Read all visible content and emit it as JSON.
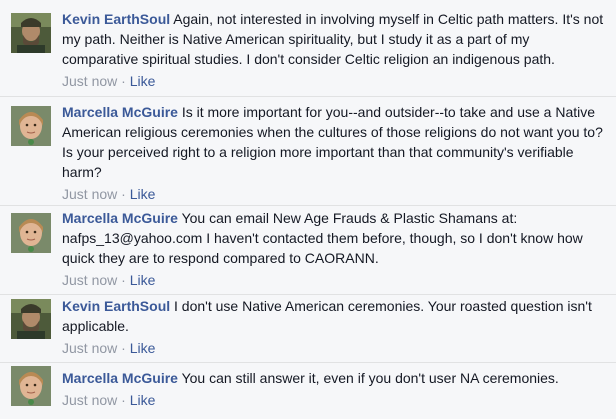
{
  "comments": [
    {
      "author": "Kevin EarthSoul",
      "avatar": "kevin-avatar",
      "text": "Again, not interested in involving myself in Celtic path matters. It's not my path. Neither is Native American spirituality, but I study it as a part of my comparative spiritual studies. I don't consider Celtic religion an indigenous path.",
      "time": "Just now",
      "separator": "·",
      "like_label": "Like"
    },
    {
      "author": "Marcella McGuire",
      "avatar": "marcella-avatar",
      "text": "Is it more important for you--and outsider--to take and use a Native American religious ceremonies when the cultures of those religions do not want you to? Is your perceived right to a religion more important than that community's verifiable harm?",
      "time": "Just now",
      "separator": "·",
      "like_label": "Like"
    },
    {
      "author": "Marcella McGuire",
      "avatar": "marcella-avatar",
      "text": "You can email New Age Frauds & Plastic Shamans at: nafps_13@yahoo.com I haven't contacted them before, though, so I don't know how quick they are to respond compared to CAORANN.",
      "time": "Just now",
      "separator": "·",
      "like_label": "Like"
    },
    {
      "author": "Kevin EarthSoul",
      "avatar": "kevin-avatar",
      "text": "I don't use Native American ceremonies. Your roasted question isn't applicable.",
      "time": "Just now",
      "separator": "·",
      "like_label": "Like"
    },
    {
      "author": "Marcella McGuire",
      "avatar": "marcella-avatar",
      "text": "You can still answer it, even if you don't user NA ceremonies.",
      "time": "Just now",
      "separator": "·",
      "like_label": "Like"
    }
  ],
  "colors": {
    "author": "#3b5998",
    "meta": "#9197a3",
    "background": "#f6f7f9",
    "divider": "#e1e2e3"
  }
}
